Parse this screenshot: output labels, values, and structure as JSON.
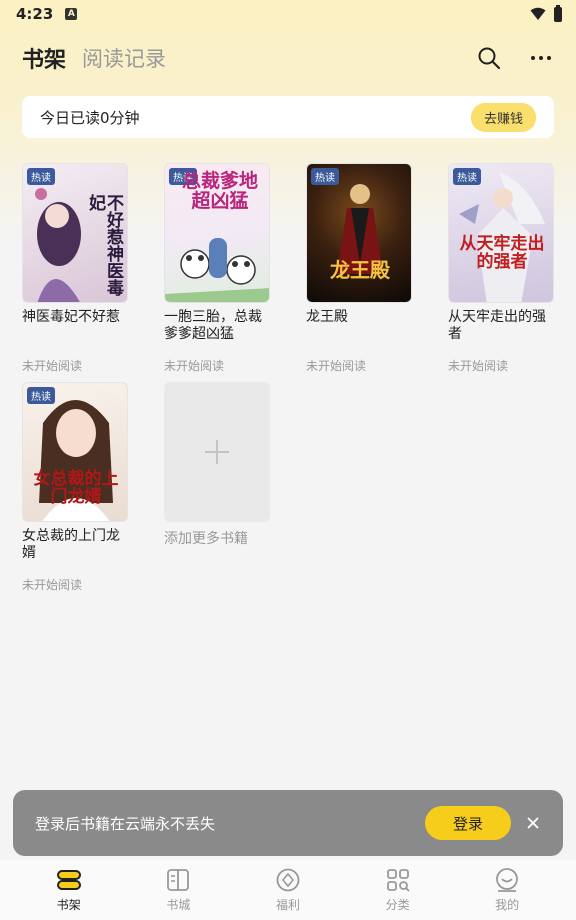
{
  "status_bar": {
    "time": "4:23",
    "app_badge": "A"
  },
  "header": {
    "tab_shelf": "书架",
    "tab_history": "阅读记录"
  },
  "reading": {
    "text": "今日已读0分钟",
    "earn_label": "去赚钱"
  },
  "books": [
    {
      "badge": "热读",
      "cover_text": "不好惹神医毒妃",
      "title": "神医毒妃不好惹",
      "status": "未开始阅读",
      "colors": [
        "#f2e9f1",
        "#c9b5c8"
      ],
      "text_color": "#2b1b3d"
    },
    {
      "badge": "热读",
      "cover_text": "总裁爹地超凶猛",
      "title": "一胞三胎，总裁爹爹超凶猛",
      "status": "未开始阅读",
      "colors": [
        "#f9e7f0",
        "#e4f2e2"
      ],
      "text_color": "#b9257c"
    },
    {
      "badge": "热读",
      "cover_text": "龙王殿",
      "title": "龙王殿",
      "status": "未开始阅读",
      "colors": [
        "#4a2a12",
        "#0d0907"
      ],
      "text_color": "#f2c441"
    },
    {
      "badge": "热读",
      "cover_text": "从天牢走出的强者",
      "title": "从天牢走出的强者",
      "status": "未开始阅读",
      "colors": [
        "#e7e0ef",
        "#cdc3de"
      ],
      "text_color": "#c01f1f"
    },
    {
      "badge": "热读",
      "cover_text": "女总裁的上门龙婿",
      "title": "女总裁的上门龙婿",
      "status": "未开始阅读",
      "colors": [
        "#f7efe9",
        "#e9dcd2"
      ],
      "text_color": "#b01818"
    }
  ],
  "add_more": {
    "label": "添加更多书籍"
  },
  "login_banner": {
    "text": "登录后书籍在云端永不丢失",
    "button": "登录"
  },
  "bottom_nav": [
    {
      "label": "书架",
      "icon": "bookshelf-icon",
      "active": true
    },
    {
      "label": "书城",
      "icon": "book-open-icon",
      "active": false
    },
    {
      "label": "福利",
      "icon": "coin-icon",
      "active": false
    },
    {
      "label": "分类",
      "icon": "category-grid-icon",
      "active": false
    },
    {
      "label": "我的",
      "icon": "profile-icon",
      "active": false
    }
  ]
}
